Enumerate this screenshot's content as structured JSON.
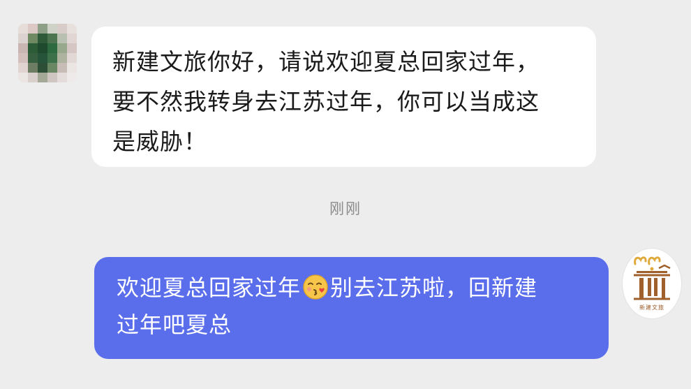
{
  "messages": [
    {
      "direction": "incoming",
      "lines": [
        "新建文旅你好，请说欢迎夏总回家过年，",
        "要不然我转身去江苏过年，你可以当成这",
        "是威胁！"
      ]
    },
    {
      "direction": "outgoing",
      "line1_before_emoji": "欢迎夏总回家过年",
      "emoji": "blowing-kiss-emoji",
      "line1_after_emoji": "别去江苏啦，回新建",
      "line2": "过年吧夏总"
    }
  ],
  "timestamp": "刚刚",
  "right_avatar_logo": {
    "caption": "新建文旅",
    "accent_color": "#a0602b",
    "secondary_color": "#e0a93b"
  },
  "colors": {
    "background": "#ededed",
    "incoming_bubble": "#ffffff",
    "outgoing_bubble": "#5a6eec"
  }
}
